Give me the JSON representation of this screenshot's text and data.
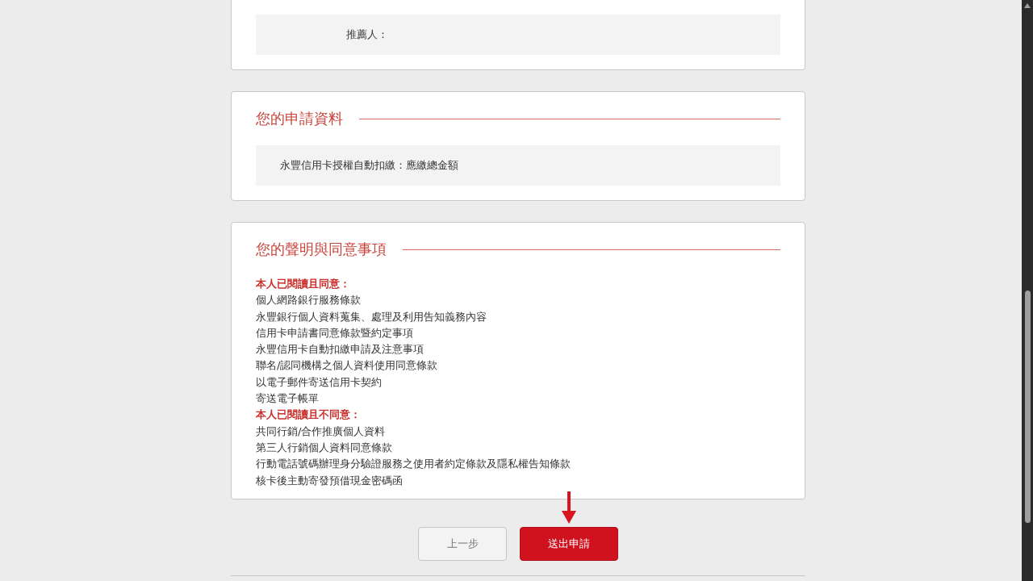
{
  "referrer_card": {
    "label": "推薦人："
  },
  "application_card": {
    "title": "您的申請資料",
    "detail": "永豐信用卡授權自動扣繳：應繳總金額"
  },
  "declaration_card": {
    "title": "您的聲明與同意事項",
    "groups": [
      {
        "heading": "本人已閱讀且同意：",
        "items": [
          "個人網路銀行服務條款",
          "永豐銀行個人資料蒐集、處理及利用告知義務內容",
          "信用卡申請書同意條款暨約定事項",
          "永豐信用卡自動扣繳申請及注意事項",
          "聯名/認同機構之個人資料使用同意條款",
          "以電子郵件寄送信用卡契約",
          "寄送電子帳單"
        ]
      },
      {
        "heading": "本人已閱讀且不同意：",
        "items": [
          "共同行銷/合作推廣個人資料",
          "第三人行銷個人資料同意條款",
          "行動電話號碼辦理身分驗證服務之使用者約定條款及隱私權告知條款",
          "核卡後主動寄發預借現金密碼函"
        ]
      }
    ]
  },
  "buttons": [
    {
      "label": "上一步",
      "kind": "secondary"
    },
    {
      "label": "送出申請",
      "kind": "primary",
      "highlighted": true
    }
  ]
}
